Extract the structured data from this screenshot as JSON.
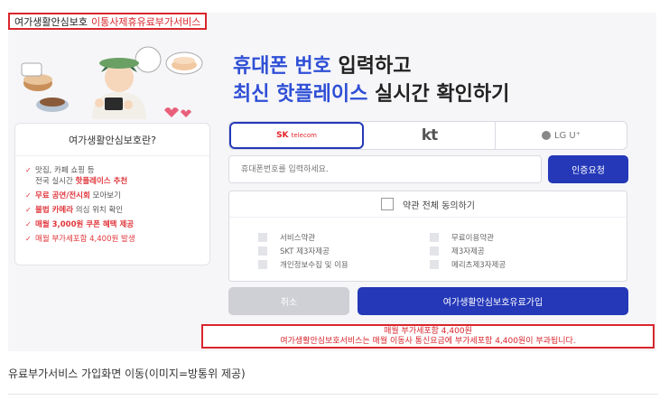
{
  "header": {
    "service_name": "여가생활안심보호",
    "service_type": "이통사제휴유료부가서비스"
  },
  "headline": {
    "line1_highlight": "휴대폰 번호",
    "line1_rest": "입력하고",
    "line2_highlight": "최신 핫플레이스",
    "line2_rest": "실시간 확인하기"
  },
  "info": {
    "title": "여가생활안심보호란?",
    "item1_plain": "맛집, 카페 쇼핑 등",
    "item1_line2_plain": "전국 실시간 ",
    "item1_line2_red": "핫플레이스 추천",
    "item2_red": "무료 공연/전시회",
    "item2_plain": " 모아보기",
    "item3_red": "불법 카메라",
    "item3_plain": " 의심 위치 확인",
    "item4_red": "매월 3,000원 쿠폰 혜택 제공",
    "item5": "매월 부가세포함 4,400원 발생"
  },
  "carriers": {
    "sk_brand": "SK",
    "sk_sub": "telecom",
    "kt": "kt",
    "lgu": "LG U⁺",
    "selected": "SK telecom"
  },
  "form": {
    "phone_placeholder": "휴대폰번호를 입력하세요.",
    "auth_button": "인증요청",
    "agree_all": "약관 전체 동의하기",
    "terms": [
      "서비스약관",
      "무료이용약관",
      "SKT 제3자제공",
      "제3자제공",
      "개인정보수집 및 이용",
      "메리츠제3자제공"
    ],
    "cancel_button": "취소",
    "join_button": "여가생활안심보호유료가입"
  },
  "notice": {
    "line1": "매월 부가세포함 4,400원",
    "line2": "여가생활안심보호서비스는 매월 이동사 통신요금에 부가세포함 4,400원이 부과됩니다."
  },
  "caption": "유료부가서비스 가입화면 이동(이미지=방통위 제공)",
  "colors": {
    "accent_blue": "#2438b8",
    "highlight_blue": "#2f4fd6",
    "red": "#d9262c",
    "panel_bg": "#f6f6f8"
  }
}
